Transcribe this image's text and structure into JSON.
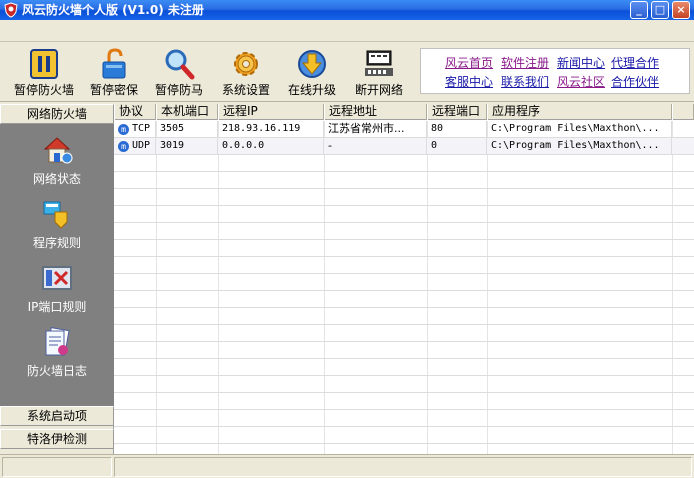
{
  "window": {
    "title": "风云防火墙个人版 (V1.0) 未注册",
    "buttons": {
      "minimize": "_",
      "maximize": "□",
      "close": "×"
    }
  },
  "toolbar": {
    "buttons": [
      {
        "label": "暂停防火墙",
        "icon": "pause-icon"
      },
      {
        "label": "暂停密保",
        "icon": "unlock-icon"
      },
      {
        "label": "暂停防马",
        "icon": "magnifier-icon"
      },
      {
        "label": "系统设置",
        "icon": "gear-icon"
      },
      {
        "label": "在线升级",
        "icon": "download-globe-icon"
      },
      {
        "label": "断开网络",
        "icon": "network-icon"
      }
    ]
  },
  "links": [
    {
      "label": "风云首页",
      "visited": true
    },
    {
      "label": "软件注册",
      "visited": true
    },
    {
      "label": "新闻中心",
      "visited": false
    },
    {
      "label": "代理合作",
      "visited": false
    },
    {
      "label": "客服中心",
      "visited": false
    },
    {
      "label": "联系我们",
      "visited": false
    },
    {
      "label": "风云社区",
      "visited": true
    },
    {
      "label": "合作伙伴",
      "visited": false
    }
  ],
  "sidebar": {
    "header": "网络防火墙",
    "items": [
      {
        "label": "网络状态",
        "icon": "house-network-icon"
      },
      {
        "label": "程序规则",
        "icon": "program-rules-icon"
      },
      {
        "label": "IP端口规则",
        "icon": "ip-port-icon"
      },
      {
        "label": "防火墙日志",
        "icon": "log-icon"
      }
    ],
    "sections": [
      "系统启动项",
      "特洛伊检测"
    ]
  },
  "table": {
    "columns": [
      "协议",
      "本机端口",
      "远程IP",
      "远程地址",
      "远程端口",
      "应用程序"
    ],
    "rows": [
      {
        "protocol": "TCP",
        "local_port": "3505",
        "remote_ip": "218.93.16.119",
        "remote_addr": "江苏省常州市...",
        "remote_port": "80",
        "app": "C:\\Program Files\\Maxthon\\..."
      },
      {
        "protocol": "UDP",
        "local_port": "3019",
        "remote_ip": "0.0.0.0",
        "remote_addr": "-",
        "remote_port": "0",
        "app": "C:\\Program Files\\Maxthon\\..."
      }
    ]
  },
  "colors": {
    "titlebar": "#0a50d8",
    "sidebar_panel": "#808080",
    "link": "#1a1aa8",
    "visited_link": "#8a1a8a"
  }
}
